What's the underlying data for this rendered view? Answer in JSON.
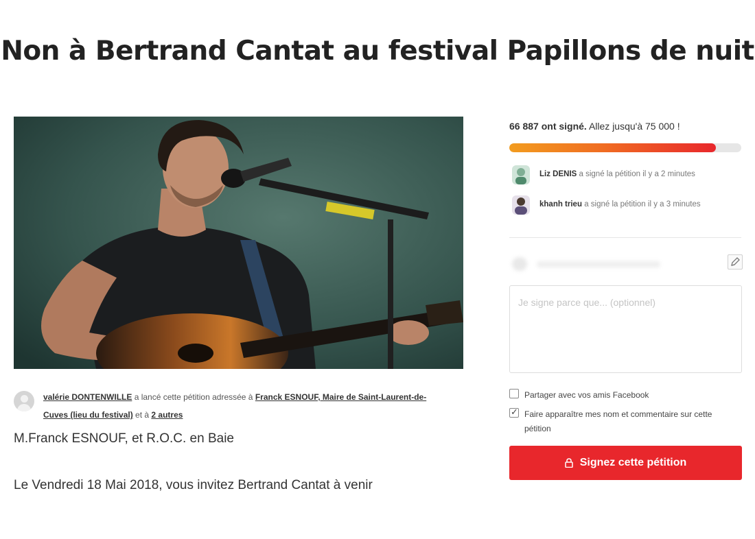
{
  "petition": {
    "title": "Non à Bertrand Cantat au festival Papillons de nuit"
  },
  "author": {
    "name": "valérie DONTENWILLE",
    "text1": "a lancé cette pétition adressée à",
    "target": "Franck ESNOUF, Maire de Saint-Laurent-de-Cuves (lieu du festival)",
    "text2": "et à",
    "others_link": "2 autres"
  },
  "body": {
    "paragraph1": "M.Franck ESNOUF, et R.O.C. en Baie",
    "paragraph2": "Le Vendredi 18 Mai 2018, vous invitez Bertrand Cantat à venir"
  },
  "signatures": {
    "count_text": "66 887 ont signé.",
    "goal_text": "Allez jusqu'à 75 000 !",
    "progress_fraction": 0.89,
    "recent": [
      {
        "name": "Liz DENIS",
        "action": "a signé la pétition il y a 2 minutes"
      },
      {
        "name": "khanh trieu",
        "action": "a signé la pétition il y a 3 minutes"
      }
    ]
  },
  "form": {
    "comment_placeholder": "Je signe parce que... (optionnel)",
    "share_facebook_label": "Partager avec vos amis Facebook",
    "share_facebook_checked": false,
    "display_name_label": "Faire apparaître mes nom et commentaire sur cette pétition",
    "display_name_checked": true,
    "sign_button_label": "Signez cette pétition"
  },
  "colors": {
    "accent": "#e8272c",
    "progress_start": "#f29c1f"
  },
  "icons": {
    "edit": "pencil-icon",
    "sign": "lock-icon"
  }
}
